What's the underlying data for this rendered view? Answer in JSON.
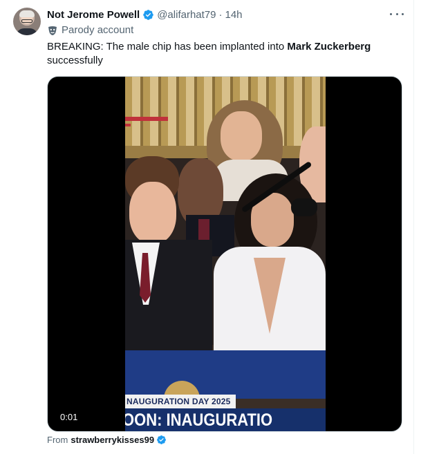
{
  "author": {
    "display_name": "Not Jerome Powell",
    "handle": "@alifarhat79",
    "separator": "·",
    "time": "14h",
    "label_text": "Parody account",
    "label_icon": "parody-mask-icon",
    "verified_color": "#1d9bf0"
  },
  "tweet": {
    "text_before": "BREAKING: The male chip has been implanted into ",
    "text_bold": "Mark Zuckerberg",
    "text_after": " successfully"
  },
  "media": {
    "timestamp": "0:01",
    "chyron_top": "NAUGURATION DAY 2025",
    "chyron_main": "OON: INAUGURATIO"
  },
  "source": {
    "prefix": "From",
    "user": "strawberrykisses99"
  },
  "icons": {
    "more": "more-icon",
    "verified": "verified-badge-icon"
  }
}
